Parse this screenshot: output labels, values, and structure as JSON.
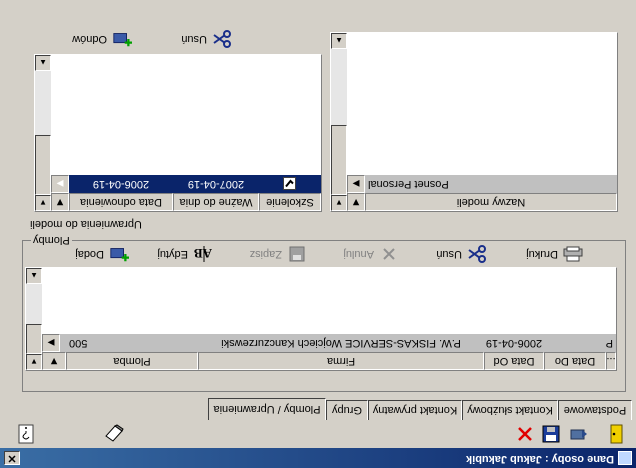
{
  "window": {
    "title": "Dane osoby : Jakub Jakubik",
    "close_glyph": "✕"
  },
  "toolbar": {
    "icons": [
      "exit-door-icon",
      "prev-record-icon",
      "save-disk-icon",
      "delete-x-icon",
      "eraser-icon",
      "help-icon"
    ]
  },
  "tabs": [
    "Podstawowe",
    "Kontakt służbowy",
    "Kontakt prywatny",
    "Grupy",
    "Plomby / Uprawnienia"
  ],
  "active_tab": "Plomby / Uprawnienia",
  "plomby": {
    "group_label": "Plomby",
    "columns": [
      "Plomba",
      "Firma",
      "Data Od",
      "Data Do",
      "..."
    ],
    "rows": [
      {
        "plomba": "500",
        "firma": "P.W. FISKAS-SERVICE Wojciech Kanczurzewski",
        "data_od": "2006-04-19",
        "data_do": "",
        "extra": "P"
      }
    ],
    "buttons": {
      "dodaj": "Dodaj",
      "edytuj": "Edytuj",
      "zapisz": "Zapisz",
      "anuluj": "Anuluj",
      "usun": "Usuń",
      "drukuj": "Drukuj"
    }
  },
  "uprawnienia": {
    "group_label": "Uprawnienia do modeli",
    "columns": [
      "Data odnowienia",
      "Ważne do dnia",
      "Szkolenie"
    ],
    "rows": [
      {
        "data_odnowienia": "2006-04-19",
        "wazne_do": "2007-04-19",
        "szkolenie_checked": true
      }
    ],
    "buttons": {
      "odnow": "Odnów",
      "usun": "Usuń"
    }
  },
  "modele": {
    "columns": [
      "Nazwy modeli"
    ],
    "rows": [
      "Posnet Personal"
    ]
  }
}
